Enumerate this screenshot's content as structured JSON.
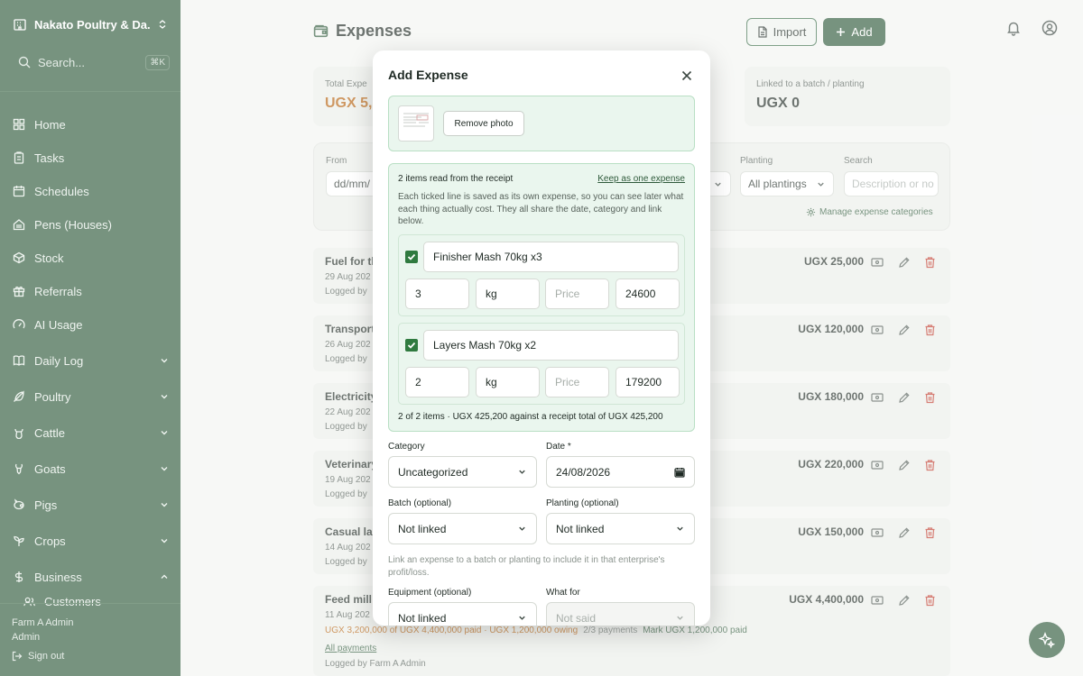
{
  "sidebar": {
    "farm_name": "Nakato Poultry & Da...",
    "search_label": "Search...",
    "search_shortcut": "⌘K",
    "items": [
      {
        "label": "Home",
        "icon": "home-icon"
      },
      {
        "label": "Tasks",
        "icon": "clipboard-icon"
      },
      {
        "label": "Schedules",
        "icon": "calendar-icon"
      },
      {
        "label": "Pens (Houses)",
        "icon": "house-icon"
      },
      {
        "label": "Stock",
        "icon": "box-icon"
      },
      {
        "label": "Referrals",
        "icon": "gift-icon"
      },
      {
        "label": "AI Usage",
        "icon": "gauge-icon"
      },
      {
        "label": "Daily Log",
        "icon": "book-icon",
        "chevron": "down"
      },
      {
        "label": "Poultry",
        "icon": "feather-icon",
        "chevron": "down"
      },
      {
        "label": "Cattle",
        "icon": "cattle-icon",
        "chevron": "down"
      },
      {
        "label": "Goats",
        "icon": "goat-icon",
        "chevron": "down"
      },
      {
        "label": "Pigs",
        "icon": "pig-icon",
        "chevron": "down"
      },
      {
        "label": "Crops",
        "icon": "sprout-icon",
        "chevron": "down"
      },
      {
        "label": "Business",
        "icon": "dollar-icon",
        "chevron": "up"
      },
      {
        "label": "Customers",
        "icon": "users-icon"
      }
    ],
    "user_name": "Farm A Admin",
    "user_role": "Admin",
    "sign_out": "Sign out"
  },
  "header": {
    "title": "Expenses",
    "import_label": "Import",
    "add_label": "Add"
  },
  "stats": {
    "total_label": "Total Expe",
    "total_value": "UGX 5,2",
    "linked_label": "Linked to a batch / planting",
    "linked_value": "UGX 0"
  },
  "filters": {
    "from_label": "From",
    "from_value": "dd/mm/",
    "planting_label": "Planting",
    "planting_value": "All plantings",
    "search_label": "Search",
    "search_placeholder": "Description or no",
    "manage_link": "Manage expense categories"
  },
  "expenses": [
    {
      "title": "Fuel for th",
      "date": "29 Aug 202",
      "by": "Logged by",
      "amount": "UGX 25,000"
    },
    {
      "title": "Transport",
      "date": "26 Aug 202",
      "by": "Logged by",
      "amount": "UGX 120,000"
    },
    {
      "title": "Electricity",
      "date": "22 Aug 202",
      "by": "Logged by",
      "amount": "UGX 180,000"
    },
    {
      "title": "Veterinary",
      "date": "19 Aug 202",
      "by": "Logged by",
      "amount": "UGX 220,000"
    },
    {
      "title": "Casual lab",
      "date": "14 Aug 202",
      "by": "Logged by",
      "amount": "UGX 150,000"
    },
    {
      "title": "Feed mill",
      "date": "11 Aug 202",
      "amount": "UGX 4,400,000",
      "payment_summary": "UGX 3,200,000 of UGX 4,400,000 paid · UGX 1,200,000 owing",
      "payment_count": "2/3 payments",
      "mark_paid": "Mark UGX 1,200,000 paid",
      "all_payments": "All payments",
      "by": "Logged by Farm A Admin"
    }
  ],
  "modal": {
    "title": "Add Expense",
    "remove_photo": "Remove photo",
    "receipt_heading": "2 items read from the receipt",
    "keep_as_one": "Keep as one expense",
    "receipt_desc": "Each ticked line is saved as its own expense, so you can see later what each thing actually cost. They all share the date, category and link below.",
    "items": [
      {
        "name": "Finisher Mash 70kg x3",
        "qty": "3",
        "unit": "kg",
        "price_placeholder": "Price",
        "total": "24600"
      },
      {
        "name": "Layers Mash 70kg x2",
        "qty": "2",
        "unit": "kg",
        "price_placeholder": "Price",
        "total": "179200"
      }
    ],
    "summary": "2 of 2 items · UGX 425,200 against a receipt total of UGX 425,200",
    "category_label": "Category",
    "category_value": "Uncategorized",
    "date_label": "Date *",
    "date_value": "24/08/2026",
    "batch_label": "Batch (optional)",
    "batch_value": "Not linked",
    "planting_label": "Planting (optional)",
    "planting_value": "Not linked",
    "link_hint": "Link an expense to a batch or planting to include it in that enterprise's profit/loss.",
    "equipment_label": "Equipment (optional)",
    "equipment_value": "Not linked",
    "what_for_label": "What for",
    "what_for_value": "Not said"
  },
  "colors": {
    "sidebar_bg": "#2f5a3b",
    "primary": "#2f5a3b",
    "danger": "#c0392b",
    "owing": "#b5620f"
  }
}
